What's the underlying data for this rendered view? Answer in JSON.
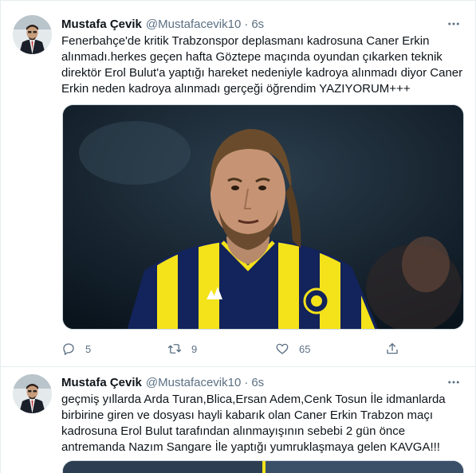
{
  "tweets": [
    {
      "author_name": "Mustafa Çevik",
      "handle": "@Mustafacevik10",
      "separator": "·",
      "time": "6s",
      "text": "Fenerbahçe'de kritik Trabzonspor deplasmanı kadrosuna Caner Erkin\nalınmadı.herkes geçen hafta Göztepe maçında oyundan çıkarken teknik\ndirektör Erol Bulut'a yaptığı hareket nedeniyle kadroya alınmadı diyor Caner\nErkin neden kadroya alınmadı gerçeği öğrendim YAZIYORUM+++",
      "reply_count": "5",
      "retweet_count": "9",
      "like_count": "65"
    },
    {
      "author_name": "Mustafa Çevik",
      "handle": "@Mustafacevik10",
      "separator": "·",
      "time": "6s",
      "text": "geçmiş yıllarda Arda Turan,Blica,Ersan Adem,Cenk Tosun İle idmanlarda\nbirbirine giren ve dosyası hayli kabarık olan Caner Erkin Trabzon maçı\nkadrosuna Erol Bulut tarafından alınmayışının sebebi 2 gün önce\nantremanda Nazım Sangare İle yaptığı yumruklaşmaya gelen KAVGA!!!"
    }
  ],
  "icons": {
    "more": "more-icon",
    "reply": "reply-icon",
    "retweet": "retweet-icon",
    "like": "like-icon",
    "share": "share-icon"
  },
  "colors": {
    "text_primary": "#0f1419",
    "text_secondary": "#5b7083",
    "border": "#e6ecf0",
    "jersey_navy": "#13235b",
    "jersey_yellow": "#f4e21a"
  }
}
